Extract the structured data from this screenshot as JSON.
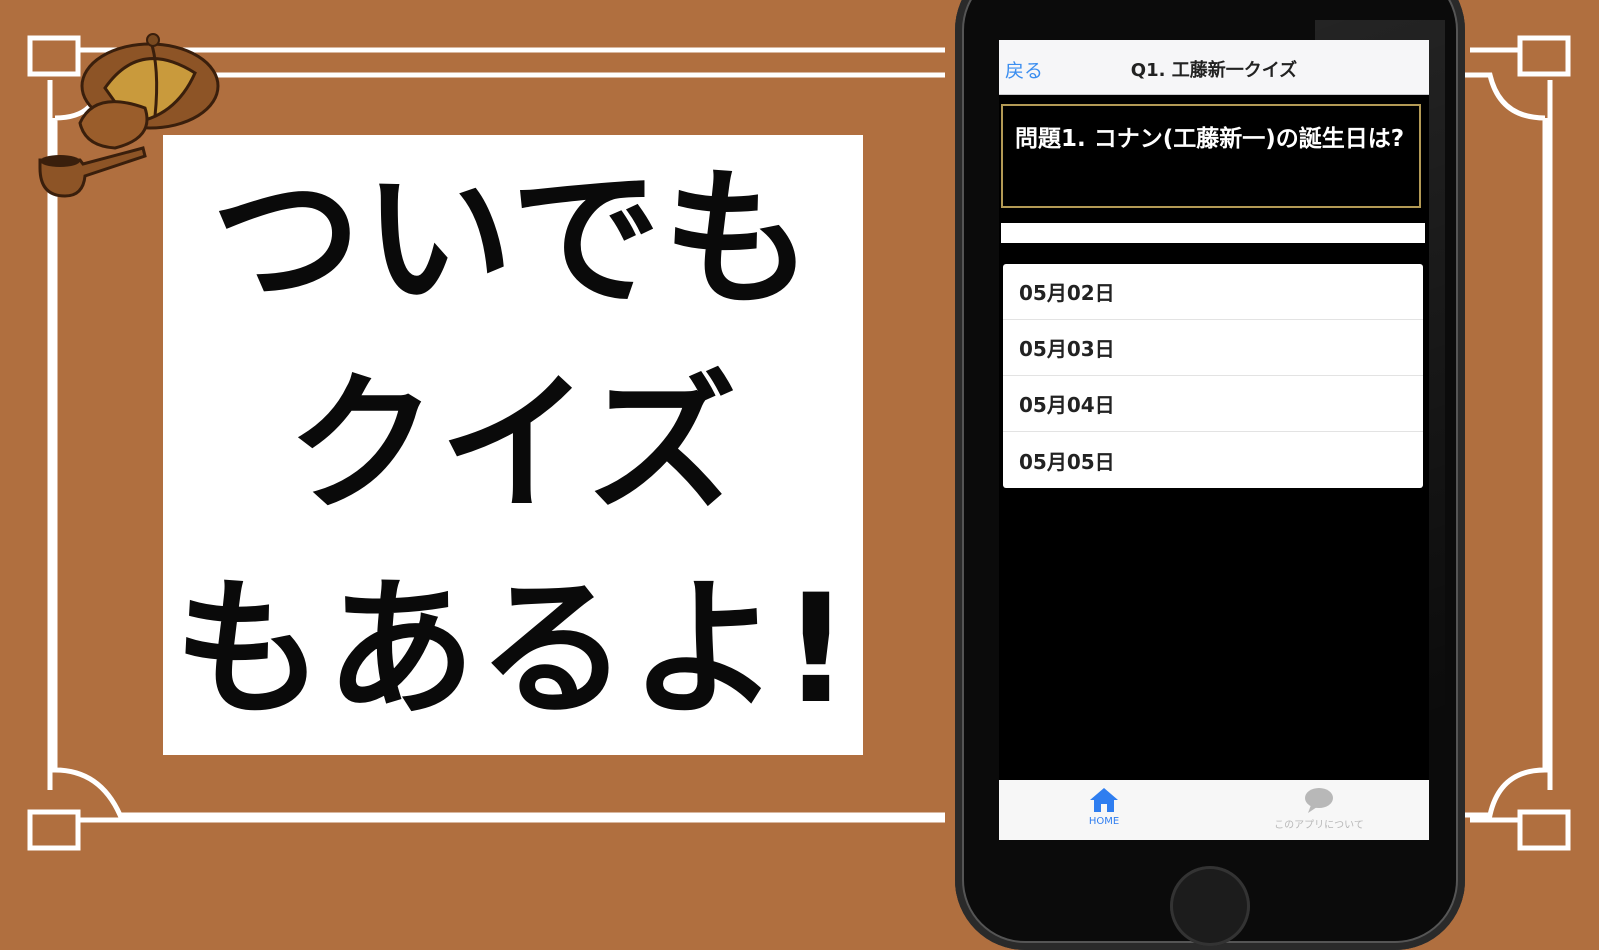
{
  "promo": {
    "lines": [
      "ついでも",
      "クイズ",
      "もあるよ!"
    ]
  },
  "phone": {
    "navbar": {
      "back": "戻る",
      "title": "Q1. 工藤新一クイズ"
    },
    "question": "問題1. コナン(工藤新一)の誕生日は?",
    "answers": [
      "05月02日",
      "05月03日",
      "05月04日",
      "05月05日"
    ],
    "tabs": [
      {
        "label": "HOME",
        "icon": "home-icon",
        "active": true
      },
      {
        "label": "このアプリについて",
        "icon": "speech-bubble-icon",
        "active": false
      }
    ]
  },
  "colors": {
    "background": "#b06f3f",
    "frame": "#ffffff",
    "accent_blue": "#3b8ef0",
    "question_border": "#b39a55"
  }
}
